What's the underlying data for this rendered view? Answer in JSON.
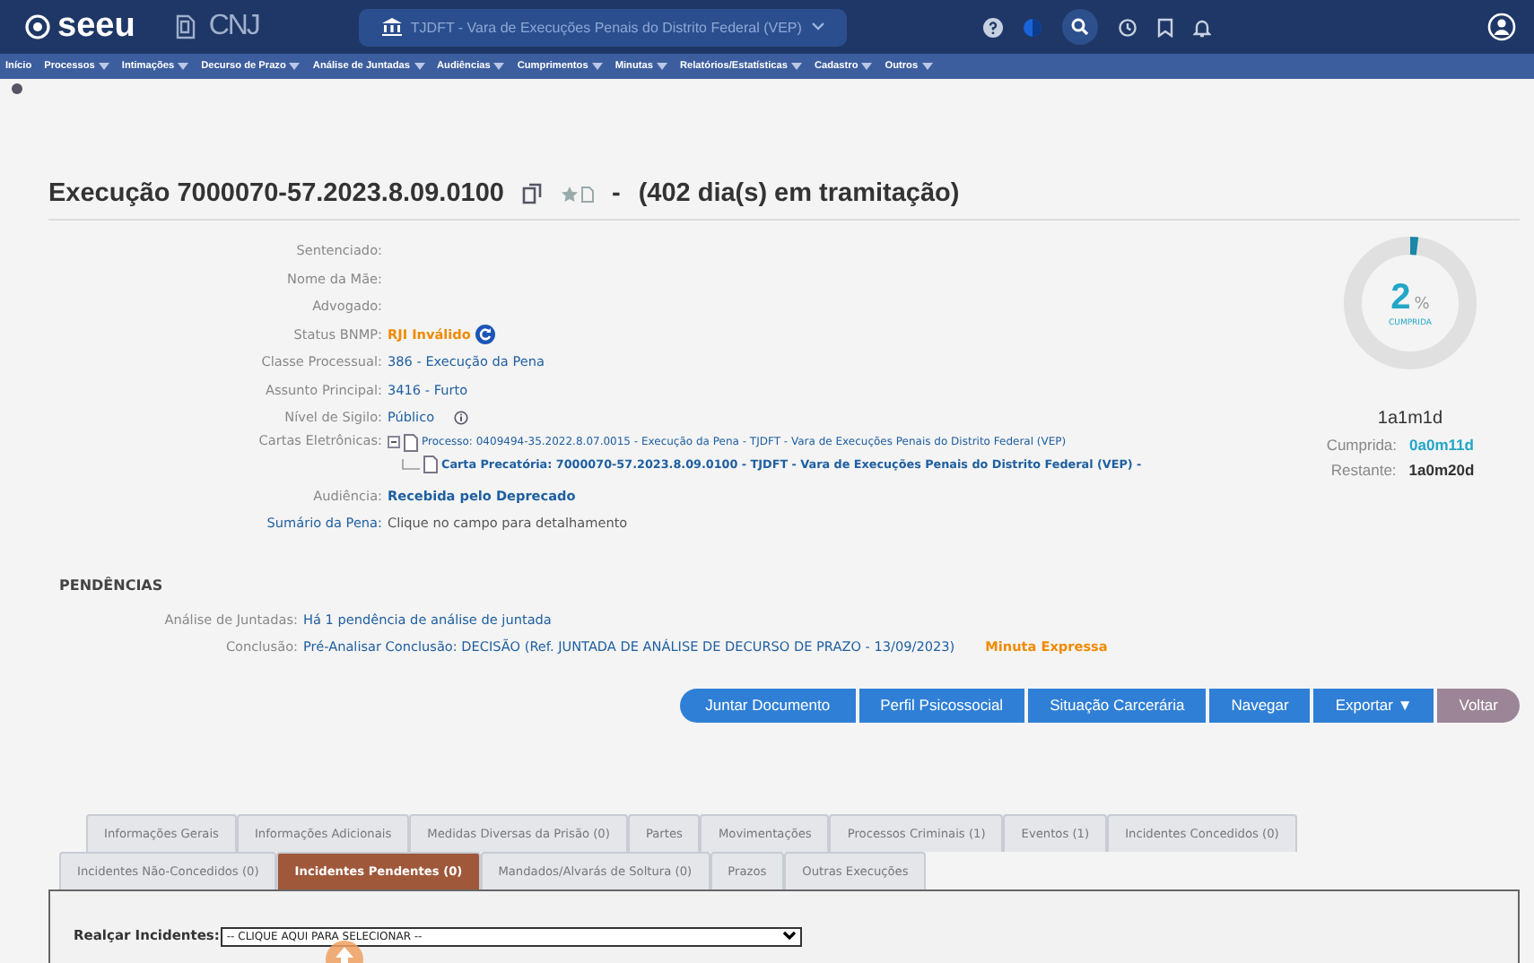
{
  "header": {
    "logo": "seeu",
    "org": "CNJ",
    "court": "TJDFT - Vara de Execuções Penais do Distrito Federal (VEP)"
  },
  "menu": [
    {
      "label": "Início",
      "dropdown": false
    },
    {
      "label": "Processos",
      "dropdown": true
    },
    {
      "label": "Intimações",
      "dropdown": true
    },
    {
      "label": "Decurso de Prazo",
      "dropdown": true
    },
    {
      "label": "Análise de Juntadas",
      "dropdown": true
    },
    {
      "label": "Audiências",
      "dropdown": true
    },
    {
      "label": "Cumprimentos",
      "dropdown": true
    },
    {
      "label": "Minutas",
      "dropdown": true
    },
    {
      "label": "Relatórios/Estatísticas",
      "dropdown": true
    },
    {
      "label": "Cadastro",
      "dropdown": true
    },
    {
      "label": "Outros",
      "dropdown": true
    }
  ],
  "title": {
    "text": "Execução 7000070-57.2023.8.09.0100",
    "separator": "-",
    "days": "(402 dia(s) em tramitação)"
  },
  "fields": [
    {
      "label": "Sentenciado:",
      "kind": "empty"
    },
    {
      "label": "Nome da Mãe:",
      "kind": "empty"
    },
    {
      "label": "Advogado:",
      "kind": "empty"
    },
    {
      "label": "Status BNMP:",
      "kind": "status",
      "value": "RJI Inválido"
    },
    {
      "label": "Classe Processual:",
      "kind": "link",
      "value": "386 - Execução da Pena"
    },
    {
      "label": "Assunto Principal:",
      "kind": "link",
      "value": "3416 - Furto"
    },
    {
      "label": "Nível de Sigilo:",
      "kind": "info",
      "value": "Público"
    },
    {
      "label": "Cartas Eletrônicas:",
      "kind": "tree",
      "items": [
        "Processo: 0409494-35.2022.8.07.0015 - Execução da Pena - TJDFT - Vara de Execuções Penais do Distrito Federal (VEP)",
        "Carta Precatória: 7000070-57.2023.8.09.0100 - TJDFT - Vara de Execuções Penais do Distrito Federal (VEP) -"
      ]
    },
    {
      "label": "Audiência:",
      "kind": "bold",
      "value": "Recebida pelo Deprecado"
    },
    {
      "label": "Sumário da Pena:",
      "kind": "plain",
      "value": "Clique no campo para detalhamento"
    }
  ],
  "progress": {
    "percent": "2",
    "unit": "%",
    "caption": "CUMPRIDA",
    "level": 0.02,
    "total": "1a1m1d",
    "rows": [
      {
        "label": "Cumprida:",
        "value": "0a0m11d",
        "kind": "done"
      },
      {
        "label": "Restante:",
        "value": "1a0m20d",
        "kind": "left"
      }
    ]
  },
  "pendencias": {
    "heading": "PENDÊNCIAS",
    "rows": [
      {
        "label": "Análise de Juntadas:",
        "value": "Há 1 pendência de análise de juntada"
      },
      {
        "label": "Conclusão:",
        "value": "Pré-Analisar Conclusão: DECISÃO (Ref. JUNTADA DE ANÁLISE DE DECURSO DE PRAZO - 13/09/2023)",
        "tag": "Minuta Expressa"
      }
    ]
  },
  "buttons": [
    {
      "label": "Juntar Documento",
      "kind": "primary"
    },
    {
      "label": "Perfil Psicossocial",
      "kind": "primary"
    },
    {
      "label": "Situação Carcerária",
      "kind": "primary"
    },
    {
      "label": "Navegar",
      "kind": "primary"
    },
    {
      "label": "Exportar ▼",
      "kind": "primary"
    },
    {
      "label": "Voltar",
      "kind": "back"
    }
  ],
  "tabs": [
    [
      {
        "label": "Informações Gerais",
        "selected": false
      },
      {
        "label": "Informações Adicionais",
        "selected": false
      },
      {
        "label": "Medidas Diversas da Prisão (0)",
        "selected": false
      },
      {
        "label": "Partes",
        "selected": false
      },
      {
        "label": "Movimentações",
        "selected": false
      },
      {
        "label": "Processos Criminais (1)",
        "selected": false
      },
      {
        "label": "Eventos (1)",
        "selected": false
      },
      {
        "label": "Incidentes Concedidos (0)",
        "selected": false
      }
    ],
    [
      {
        "label": "Incidentes Não-Concedidos (0)",
        "selected": false
      },
      {
        "label": "Incidentes Pendentes (0)",
        "selected": true
      },
      {
        "label": "Mandados/Alvarás de Soltura (0)",
        "selected": false
      },
      {
        "label": "Prazos",
        "selected": false
      },
      {
        "label": "Outras Execuções",
        "selected": false
      }
    ]
  ],
  "filter": {
    "label": "Realçar Incidentes:",
    "value": "-- CLIQUE AQUI PARA SELECIONAR --"
  }
}
